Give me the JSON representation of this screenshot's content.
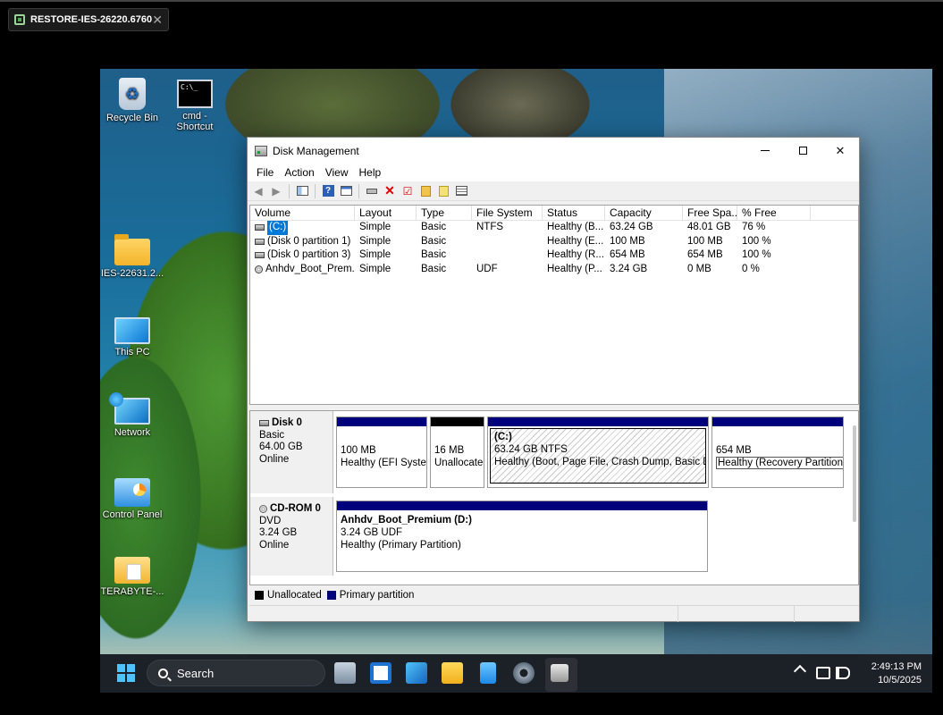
{
  "viewer": {
    "tab_title": "RESTORE-IES-26220.6760"
  },
  "desktop_icons": [
    {
      "label": "Recycle Bin",
      "icon": "recycle-bin-icon"
    },
    {
      "label": "cmd - Shortcut",
      "icon": "cmd-shortcut-icon",
      "icon_text": "C:\\_"
    },
    {
      "label": "IES-22631.2...",
      "icon": "folder-icon"
    },
    {
      "label": "This PC",
      "icon": "this-pc-icon"
    },
    {
      "label": "Network",
      "icon": "network-icon"
    },
    {
      "label": "Control Panel",
      "icon": "control-panel-icon"
    },
    {
      "label": "TERABYTE-...",
      "icon": "folder-icon"
    }
  ],
  "window": {
    "title": "Disk Management",
    "menu": [
      "File",
      "Action",
      "View",
      "Help"
    ],
    "columns": [
      "Volume",
      "Layout",
      "Type",
      "File System",
      "Status",
      "Capacity",
      "Free Spa...",
      "% Free"
    ],
    "volumes": [
      {
        "volume": "(C:)",
        "layout": "Simple",
        "type": "Basic",
        "fs": "NTFS",
        "status": "Healthy (B...",
        "capacity": "63.24 GB",
        "free": "48.01 GB",
        "pct": "76 %",
        "selected": true
      },
      {
        "volume": "(Disk 0 partition 1)",
        "layout": "Simple",
        "type": "Basic",
        "fs": "",
        "status": "Healthy (E...",
        "capacity": "100 MB",
        "free": "100 MB",
        "pct": "100 %"
      },
      {
        "volume": "(Disk 0 partition 3)",
        "layout": "Simple",
        "type": "Basic",
        "fs": "",
        "status": "Healthy (R...",
        "capacity": "654 MB",
        "free": "654 MB",
        "pct": "100 %"
      },
      {
        "volume": "Anhdv_Boot_Prem...",
        "layout": "Simple",
        "type": "Basic",
        "fs": "UDF",
        "status": "Healthy (P...",
        "capacity": "3.24 GB",
        "free": "0 MB",
        "pct": "0 %"
      }
    ],
    "disks": [
      {
        "name": "Disk 0",
        "kind": "Basic",
        "size": "64.00 GB",
        "state": "Online",
        "partitions": [
          {
            "name": "",
            "size": "100 MB",
            "status": "Healthy (EFI System Partition)"
          },
          {
            "name": "",
            "size": "16 MB",
            "status": "Unallocated"
          },
          {
            "name": "(C:)",
            "size": "63.24 GB NTFS",
            "status": "Healthy (Boot, Page File, Crash Dump, Basic Data Partition)"
          },
          {
            "name": "",
            "size": "654 MB",
            "status": "Healthy (Recovery Partition)"
          }
        ]
      },
      {
        "name": "CD-ROM 0",
        "kind": "DVD",
        "size": "3.24 GB",
        "state": "Online",
        "partitions": [
          {
            "name": "Anhdv_Boot_Premium  (D:)",
            "size": "3.24 GB UDF",
            "status": "Healthy (Primary Partition)"
          }
        ]
      }
    ],
    "legend": [
      {
        "label": "Unallocated",
        "color": "#000000"
      },
      {
        "label": "Primary partition",
        "color": "#00007d"
      }
    ]
  },
  "taskbar": {
    "search_label": "Search",
    "time": "2:49:13 PM",
    "date": "10/5/2025"
  }
}
